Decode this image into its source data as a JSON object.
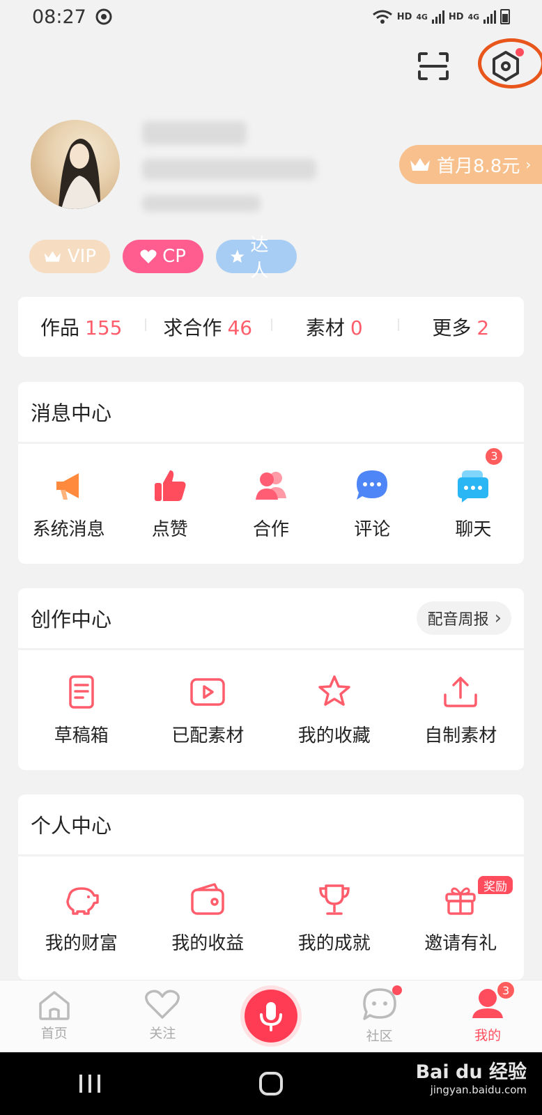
{
  "status_bar": {
    "time": "08:27",
    "network_1": "HD",
    "gen_1": "4G",
    "network_2": "HD",
    "gen_2": "4G"
  },
  "profile": {
    "vip_offer": "首月8.8元"
  },
  "badges": {
    "vip": "VIP",
    "cp": "CP",
    "daren": "达人"
  },
  "stats": [
    {
      "label": "作品",
      "value": "155"
    },
    {
      "label": "求合作",
      "value": "46"
    },
    {
      "label": "素材",
      "value": "0"
    },
    {
      "label": "更多",
      "value": "2"
    }
  ],
  "message_center": {
    "title": "消息中心",
    "items": [
      {
        "label": "系统消息",
        "icon": "megaphone-icon",
        "color": "#ff8a3d"
      },
      {
        "label": "点赞",
        "icon": "thumbs-up-icon",
        "color": "#ff4d5e"
      },
      {
        "label": "合作",
        "icon": "people-icon",
        "color": "#ff5d73"
      },
      {
        "label": "评论",
        "icon": "comment-icon",
        "color": "#4f86f7"
      },
      {
        "label": "聊天",
        "icon": "chat-icon",
        "color": "#2ab5f4",
        "badge": "3"
      }
    ]
  },
  "creation_center": {
    "title": "创作中心",
    "weekly_report": "配音周报",
    "items": [
      {
        "label": "草稿箱",
        "icon": "draft-icon"
      },
      {
        "label": "已配素材",
        "icon": "video-icon"
      },
      {
        "label": "我的收藏",
        "icon": "star-icon"
      },
      {
        "label": "自制素材",
        "icon": "upload-icon"
      }
    ]
  },
  "personal_center": {
    "title": "个人中心",
    "items": [
      {
        "label": "我的财富",
        "icon": "piggy-bank-icon"
      },
      {
        "label": "我的收益",
        "icon": "wallet-icon"
      },
      {
        "label": "我的成就",
        "icon": "trophy-icon"
      },
      {
        "label": "邀请有礼",
        "icon": "gift-icon",
        "tag": "奖励"
      }
    ]
  },
  "tab_bar": {
    "items": [
      {
        "label": "首页",
        "icon": "home-icon"
      },
      {
        "label": "关注",
        "icon": "heart-icon"
      },
      {
        "label": "",
        "icon": "microphone-icon"
      },
      {
        "label": "社区",
        "icon": "community-icon"
      },
      {
        "label": "我的",
        "icon": "profile-icon",
        "badge": "3"
      }
    ],
    "accent": "#ff4d5e"
  },
  "watermark": {
    "brand": "Bai du 经验",
    "url": "jingyan.baidu.com"
  }
}
